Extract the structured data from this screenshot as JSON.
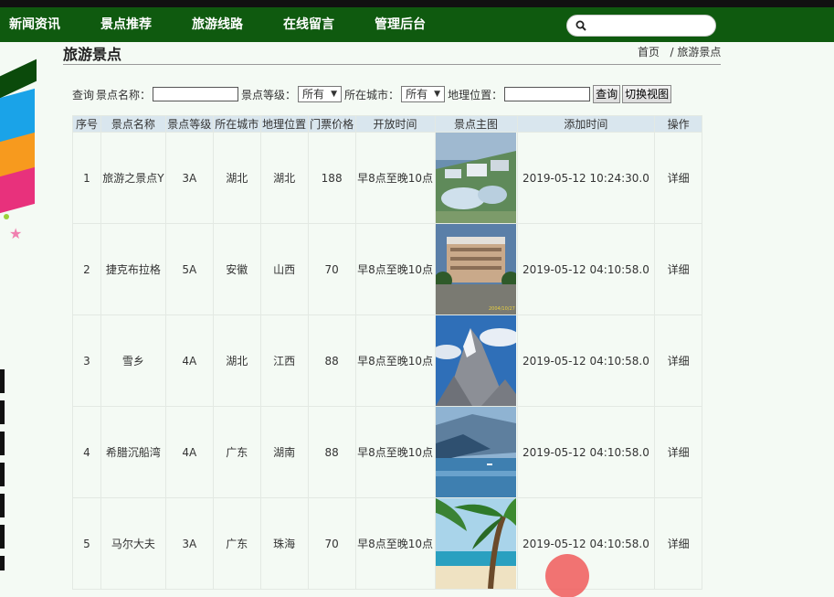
{
  "nav": {
    "items": [
      "新闻资讯",
      "景点推荐",
      "旅游线路",
      "在线留言",
      "管理后台"
    ],
    "search_placeholder": ""
  },
  "page": {
    "title": "旅游景点",
    "breadcrumb_home": "首页",
    "breadcrumb_sep": "/",
    "breadcrumb_current": "旅游景点"
  },
  "filters": {
    "query_label": "查询",
    "name_label": "景点名称：",
    "name_value": "",
    "level_label": "景点等级：",
    "level_value": "所有",
    "city_label": "所在城市：",
    "city_value": "所有",
    "location_label": "地理位置：",
    "location_value": "",
    "search_button": "查询",
    "switch_view_button": "切换视图"
  },
  "table": {
    "headers": [
      "序号",
      "景点名称",
      "景点等级",
      "所在城市",
      "地理位置",
      "门票价格",
      "开放时间",
      "景点主图",
      "添加时间",
      "操作"
    ],
    "rows": [
      {
        "no": "1",
        "name": "旅游之景点Y",
        "level": "3A",
        "city": "湖北",
        "location": "湖北",
        "price": "188",
        "hours": "早8点至晚10点",
        "image": "city-aerial-photo",
        "added": "2019-05-12 10:24:30.0",
        "action": "详细"
      },
      {
        "no": "2",
        "name": "捷克布拉格",
        "level": "5A",
        "city": "安徽",
        "location": "山西",
        "price": "70",
        "hours": "早8点至晚10点",
        "image": "building-photo",
        "added": "2019-05-12 04:10:58.0",
        "action": "详细"
      },
      {
        "no": "3",
        "name": "雪乡",
        "level": "4A",
        "city": "湖北",
        "location": "江西",
        "price": "88",
        "hours": "早8点至晚10点",
        "image": "snow-mountain-photo",
        "added": "2019-05-12 04:10:58.0",
        "action": "详细"
      },
      {
        "no": "4",
        "name": "希腊沉船湾",
        "level": "4A",
        "city": "广东",
        "location": "湖南",
        "price": "88",
        "hours": "早8点至晚10点",
        "image": "lake-photo",
        "added": "2019-05-12 04:10:58.0",
        "action": "详细"
      },
      {
        "no": "5",
        "name": "马尔大夫",
        "level": "3A",
        "city": "广东",
        "location": "珠海",
        "price": "70",
        "hours": "早8点至晚10点",
        "image": "palm-beach-photo",
        "added": "2019-05-12 04:10:58.0",
        "action": "详细"
      }
    ]
  },
  "photo_stamp": "2004/10/27",
  "colors": {
    "nav_bg": "#0f5a0f",
    "header_row_bg": "#d9e6ee",
    "page_bg": "#f4faf4"
  }
}
